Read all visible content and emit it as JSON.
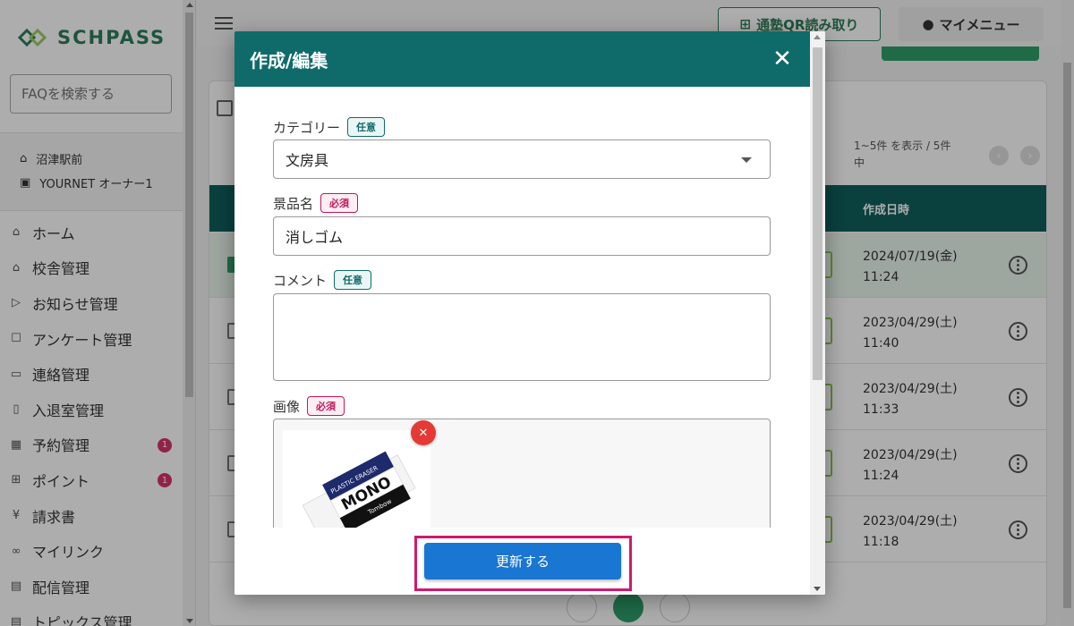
{
  "app": {
    "logo_text": "SCHPASS"
  },
  "sidebar": {
    "search_placeholder": "FAQを検索する",
    "school": {
      "name": "沼津駅前",
      "user": "YOURNET オーナー1"
    },
    "items": [
      {
        "label": "ホーム",
        "icon": "home-icon"
      },
      {
        "label": "校舎管理",
        "icon": "building-icon"
      },
      {
        "label": "お知らせ管理",
        "icon": "send-icon"
      },
      {
        "label": "アンケート管理",
        "icon": "survey-icon"
      },
      {
        "label": "連絡管理",
        "icon": "chat-icon"
      },
      {
        "label": "入退室管理",
        "icon": "door-icon"
      },
      {
        "label": "予約管理",
        "icon": "calendar-icon",
        "badge": "1"
      },
      {
        "label": "ポイント",
        "icon": "gift-icon",
        "badge": "1"
      },
      {
        "label": "請求書",
        "icon": "yen-icon"
      },
      {
        "label": "マイリンク",
        "icon": "link-icon"
      },
      {
        "label": "配信管理",
        "icon": "broadcast-icon"
      },
      {
        "label": "トピックス管理",
        "icon": "topics-icon"
      }
    ]
  },
  "topbar": {
    "qr_label": "通塾QR読み取り",
    "mymenu_label": "マイメニュー"
  },
  "list": {
    "pager_text": "1~5件 を表示 / 5件中",
    "column_created": "作成日時",
    "rows": [
      {
        "date": "2024/07/19(金)",
        "time": "11:24",
        "selected": true
      },
      {
        "date": "2023/04/29(土)",
        "time": "11:40",
        "selected": false
      },
      {
        "date": "2023/04/29(土)",
        "time": "11:33",
        "selected": false
      },
      {
        "date": "2023/04/29(土)",
        "time": "11:24",
        "selected": false
      },
      {
        "date": "2023/04/29(土)",
        "time": "11:18",
        "selected": false
      }
    ]
  },
  "modal": {
    "title": "作成/編集",
    "close_icon": "close-icon",
    "category": {
      "label": "カテゴリー",
      "tag": "任意",
      "value": "文房具"
    },
    "prize_name": {
      "label": "景品名",
      "tag": "必須",
      "value": "消しゴム"
    },
    "comment": {
      "label": "コメント",
      "tag": "任意",
      "value": ""
    },
    "image": {
      "label": "画像",
      "tag": "必須",
      "brand_text": "MONO",
      "sub_text": "Tombow",
      "top_text": "PLASTIC ERASER"
    },
    "update_label": "更新する"
  },
  "colors": {
    "header_teal": "#0f6b6a",
    "primary_blue": "#1976d2",
    "highlight_magenta": "#d0196b",
    "brand_green": "#2e7d5a"
  }
}
